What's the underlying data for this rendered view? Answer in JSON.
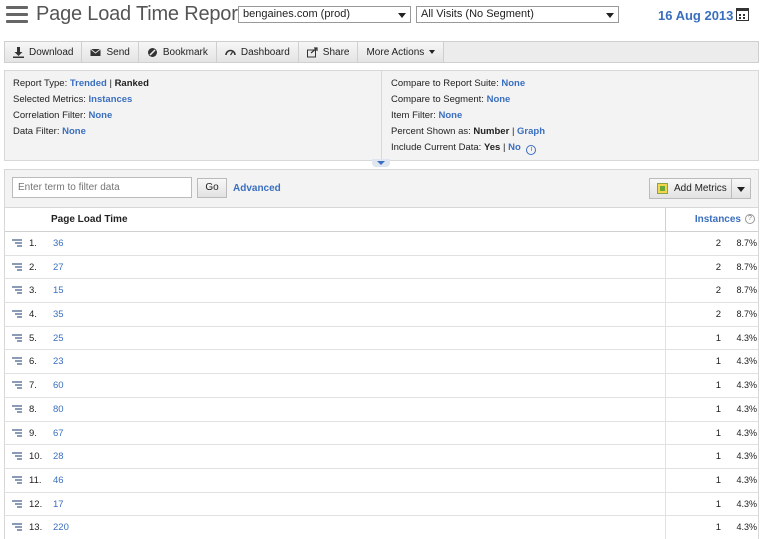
{
  "header": {
    "title": "Page Load Time Report",
    "report_suite": "bengaines.com (prod)",
    "segment": "All Visits (No Segment)",
    "date": "16 Aug 2013"
  },
  "toolbar": {
    "buttons": [
      {
        "label": "Download",
        "icon": "download-icon"
      },
      {
        "label": "Send",
        "icon": "envelope-icon"
      },
      {
        "label": "Bookmark",
        "icon": "bookmark-icon"
      },
      {
        "label": "Dashboard",
        "icon": "dashboard-icon"
      },
      {
        "label": "Share",
        "icon": "share-icon"
      },
      {
        "label": "More Actions",
        "icon": ""
      }
    ]
  },
  "info": {
    "report_type_label": "Report Type:",
    "report_type_trended": "Trended",
    "report_type_ranked": "Ranked",
    "selected_metrics_label": "Selected Metrics:",
    "selected_metrics_value": "Instances",
    "correlation_filter_label": "Correlation Filter:",
    "correlation_filter_value": "None",
    "data_filter_label": "Data Filter:",
    "data_filter_value": "None",
    "compare_suite_label": "Compare to Report Suite:",
    "compare_suite_value": "None",
    "compare_segment_label": "Compare to Segment:",
    "compare_segment_value": "None",
    "item_filter_label": "Item Filter:",
    "item_filter_value": "None",
    "percent_shown_label": "Percent Shown as:",
    "percent_shown_number": "Number",
    "percent_shown_graph": "Graph",
    "include_current_label": "Include Current Data:",
    "include_current_yes": "Yes",
    "include_current_no": "No"
  },
  "filter": {
    "placeholder": "Enter term to filter data",
    "go_label": "Go",
    "advanced_label": "Advanced",
    "add_metrics_label": "Add Metrics"
  },
  "table": {
    "dimension_header": "Page Load Time",
    "metric_header": "Instances",
    "rows": [
      {
        "rank": "1.",
        "label": "36",
        "count": "2",
        "pct": "8.7%"
      },
      {
        "rank": "2.",
        "label": "27",
        "count": "2",
        "pct": "8.7%"
      },
      {
        "rank": "3.",
        "label": "15",
        "count": "2",
        "pct": "8.7%"
      },
      {
        "rank": "4.",
        "label": "35",
        "count": "2",
        "pct": "8.7%"
      },
      {
        "rank": "5.",
        "label": "25",
        "count": "1",
        "pct": "4.3%"
      },
      {
        "rank": "6.",
        "label": "23",
        "count": "1",
        "pct": "4.3%"
      },
      {
        "rank": "7.",
        "label": "60",
        "count": "1",
        "pct": "4.3%"
      },
      {
        "rank": "8.",
        "label": "80",
        "count": "1",
        "pct": "4.3%"
      },
      {
        "rank": "9.",
        "label": "67",
        "count": "1",
        "pct": "4.3%"
      },
      {
        "rank": "10.",
        "label": "28",
        "count": "1",
        "pct": "4.3%"
      },
      {
        "rank": "11.",
        "label": "46",
        "count": "1",
        "pct": "4.3%"
      },
      {
        "rank": "12.",
        "label": "17",
        "count": "1",
        "pct": "4.3%"
      },
      {
        "rank": "13.",
        "label": "220",
        "count": "1",
        "pct": "4.3%"
      }
    ]
  },
  "colors": {
    "link": "#3a6fbf",
    "panel_bg": "#f3f3f3"
  }
}
